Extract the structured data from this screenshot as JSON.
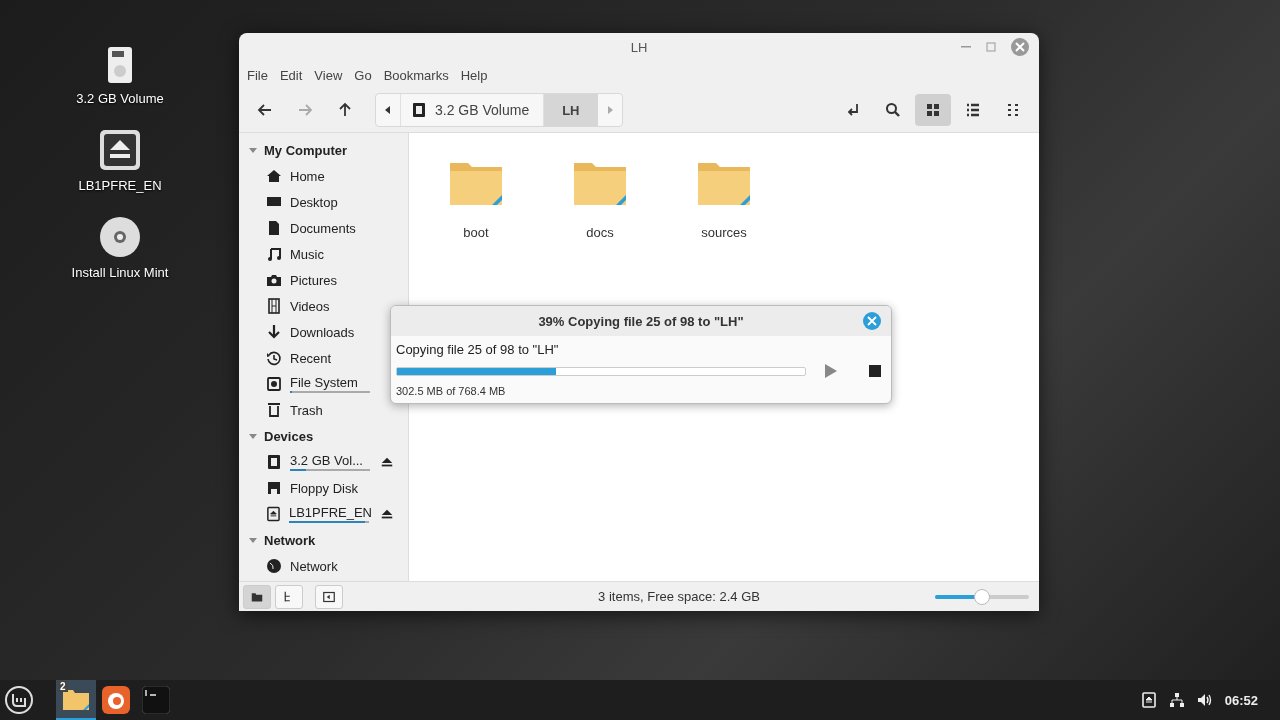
{
  "desktop_icons": [
    {
      "label": "3.2 GB Volume",
      "kind": "drive"
    },
    {
      "label": "LB1PFRE_EN",
      "kind": "removable"
    },
    {
      "label": "Install Linux Mint",
      "kind": "disc"
    }
  ],
  "window": {
    "title": "LH",
    "menu": [
      "File",
      "Edit",
      "View",
      "Go",
      "Bookmarks",
      "Help"
    ],
    "nav": [
      {
        "kind": "back",
        "disabled": false
      },
      {
        "kind": "forward",
        "disabled": true
      },
      {
        "kind": "up",
        "disabled": false
      }
    ],
    "path": [
      {
        "label": "3.2 GB Volume",
        "kind": "drive",
        "selected": false
      },
      {
        "label": "LH",
        "kind": "folder",
        "selected": true
      }
    ],
    "views": [
      {
        "kind": "icons",
        "selected": true
      },
      {
        "kind": "list",
        "selected": false
      },
      {
        "kind": "compact",
        "selected": false
      }
    ],
    "sidebar": [
      {
        "title": "My Computer",
        "expanded": true,
        "items": [
          {
            "label": "Home",
            "kind": "home"
          },
          {
            "label": "Desktop",
            "kind": "desktop"
          },
          {
            "label": "Documents",
            "kind": "documents"
          },
          {
            "label": "Music",
            "kind": "music"
          },
          {
            "label": "Pictures",
            "kind": "pictures"
          },
          {
            "label": "Videos",
            "kind": "videos"
          },
          {
            "label": "Downloads",
            "kind": "downloads"
          },
          {
            "label": "Recent",
            "kind": "recent"
          },
          {
            "label": "File System",
            "kind": "filesystem",
            "level": 0.02
          },
          {
            "label": "Trash",
            "kind": "trash"
          }
        ]
      },
      {
        "title": "Devices",
        "expanded": true,
        "items": [
          {
            "label": "3.2 GB Vol...",
            "kind": "drive",
            "level": 0.2,
            "eject": true
          },
          {
            "label": "Floppy Disk",
            "kind": "floppy"
          },
          {
            "label": "LB1PFRE_EN",
            "kind": "removable",
            "level": 0.95,
            "eject": true
          }
        ]
      },
      {
        "title": "Network",
        "expanded": true,
        "items": [
          {
            "label": "Network",
            "kind": "network"
          }
        ]
      }
    ],
    "files": [
      {
        "name": "boot"
      },
      {
        "name": "docs"
      },
      {
        "name": "sources"
      }
    ],
    "status_bar": {
      "panes": [
        {
          "kind": "places",
          "selected": true
        },
        {
          "kind": "tree",
          "selected": false
        },
        {
          "kind": "hide",
          "selected": false
        }
      ],
      "text": "3 items, Free space: 2.4 GB",
      "zoom": {
        "level": 0.5
      }
    }
  },
  "dialog": {
    "title": "39% Copying file 25 of 98 to \"LH\"",
    "message": "Copying file 25 of 98 to \"LH\"",
    "level": 0.39,
    "size": "302.5 MB of 768.4 MB",
    "paused": false
  },
  "taskbar": {
    "apps": [
      {
        "kind": "files",
        "selected": true,
        "badge": "2"
      },
      {
        "kind": "firefox",
        "selected": false
      },
      {
        "kind": "terminal",
        "selected": false
      }
    ],
    "clock": "06:52"
  }
}
